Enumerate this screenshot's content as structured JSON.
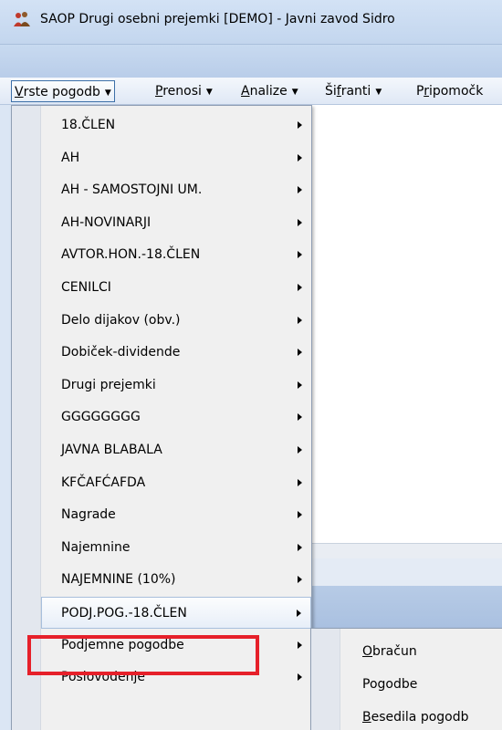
{
  "window": {
    "title": "SAOP Drugi osebni prejemki [DEMO] - Javni zavod Sidro"
  },
  "menubar": [
    {
      "label": "Vrste pogodb",
      "underline": "V",
      "rest": "rste pogodb"
    },
    {
      "label": "Prenosi",
      "underline": "P",
      "rest": "renosi"
    },
    {
      "label": "Analize",
      "underline": "A",
      "rest": "nalize"
    },
    {
      "label": "Šifranti",
      "prefix": "Ši",
      "underline": "f",
      "rest": "ranti"
    },
    {
      "label": "Pripomočki",
      "prefix": "P",
      "underline": "r",
      "rest": "ipomočk"
    }
  ],
  "dropdown": {
    "items": [
      "18.ČLEN",
      "AH",
      "AH - SAMOSTOJNI UM.",
      "AH-NOVINARJI",
      "AVTOR.HON.-18.ČLEN",
      "CENILCI",
      "Delo dijakov (obv.)",
      "Dobiček-dividende",
      "Drugi prejemki",
      "GGGGGGGG",
      "JAVNA BLABALA",
      "KFČAFĆAFDA",
      "Nagrade",
      "Najemnine",
      "NAJEMNINE (10%)",
      "PODJ.POG.-18.ČLEN",
      "Podjemne pogodbe",
      "Poslovodenje"
    ],
    "highlighted_index": 15
  },
  "submenu": [
    {
      "label": "Obračun",
      "underline": "O",
      "rest": "bračun"
    },
    {
      "label": "Pogodbe",
      "underline": "",
      "rest": "Pogodbe"
    },
    {
      "label": "Besedila pogodb",
      "underline": "B",
      "rest": "esedila pogodb"
    }
  ],
  "colors": {
    "highlight_box": "#e6202a",
    "menu_border": "#3c6fa8"
  },
  "icons": {
    "app": "people-icon",
    "submenu_arrow": "triangle-right-icon",
    "menu_caret": "caret-down-icon"
  }
}
